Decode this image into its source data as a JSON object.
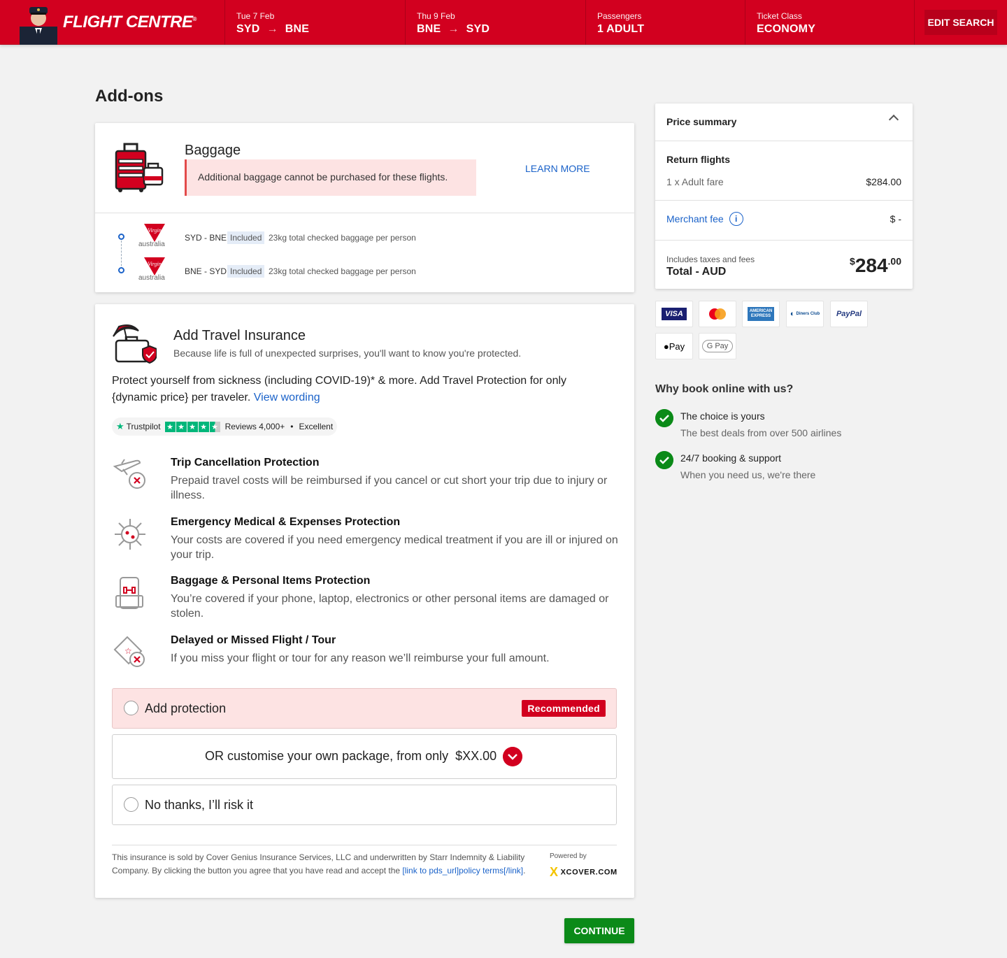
{
  "header": {
    "brand": "FLIGHT CENTRE",
    "outbound": {
      "label": "Tue 7 Feb",
      "from": "SYD",
      "to": "BNE"
    },
    "inbound": {
      "label": "Thu 9 Feb",
      "from": "BNE",
      "to": "SYD"
    },
    "passengers": {
      "label": "Passengers",
      "value": "1 ADULT"
    },
    "ticket_class": {
      "label": "Ticket Class",
      "value": "ECONOMY"
    },
    "edit_label": "EDIT SEARCH"
  },
  "page": {
    "title": "Add-ons"
  },
  "baggage": {
    "title": "Baggage",
    "alert": "Additional baggage cannot be purchased for these flights.",
    "learn_more": "LEARN MORE",
    "airline_sub": "australia",
    "legs": [
      {
        "route": "SYD - BNE",
        "status": "Included",
        "desc": "23kg total checked baggage per person"
      },
      {
        "route": "BNE - SYD",
        "status": "Included",
        "desc": "23kg total checked baggage per person"
      }
    ]
  },
  "insurance": {
    "title": "Add Travel Insurance",
    "subtitle": "Because life is full of unexpected surprises, you'll want to know you're protected.",
    "body": "Protect yourself from sickness (including COVID-19)* & more. Add Travel Protection for only {dynamic price} per traveler.",
    "view_wording": "View wording",
    "trustpilot": {
      "brand": "Trustpilot",
      "reviews": "Reviews 4,000+",
      "sep": "•",
      "rating": "Excellent"
    },
    "features": [
      {
        "title": "Trip Cancellation Protection",
        "desc": "Prepaid travel costs will be reimbursed if you cancel or cut short your trip due to injury or illness."
      },
      {
        "title": "Emergency Medical & Expenses Protection",
        "desc": "Your costs are covered if you need emergency medical treatment if you are ill or injured on your trip."
      },
      {
        "title": "Baggage & Personal Items Protection",
        "desc": "You’re covered if your phone, laptop, electronics or other personal items are damaged or stolen."
      },
      {
        "title": "Delayed or Missed Flight / Tour",
        "desc": "If you miss your flight or tour for any reason we’ll reimburse your full amount."
      }
    ],
    "opt_add": "Add protection",
    "recommended": "Recommended",
    "opt_custom": "OR customise your own package, from only  $XX.00",
    "opt_none": "No thanks, I’ll risk it",
    "legal": "This insurance is sold by Cover Genius Insurance Services, LLC and underwritten by Starr Indemnity & Liability Company. By clicking the button you agree that you have read and accept the",
    "legal_link": "[link to pds_url]policy terms[/link]",
    "legal_end": ".",
    "powered_by": "Powered by",
    "xcover": "XCOVER.COM"
  },
  "continue_label": "CONTINUE",
  "summary": {
    "title": "Price summary",
    "return_flights": "Return flights",
    "adult_fare": "1 x Adult fare",
    "adult_fare_value": "$284.00",
    "merchant_fee": "Merchant fee",
    "merchant_fee_value": "$ -",
    "includes": "Includes taxes and fees",
    "total_label": "Total - AUD",
    "total_currency": "$",
    "total_main": "284",
    "total_cents": ".00"
  },
  "payments": [
    "VISA",
    "Mastercard",
    "AMERICAN EXPRESS",
    "Diners Club",
    "PayPal",
    "Apple Pay",
    "G Pay"
  ],
  "payment_labels": {
    "visa": "VISA",
    "amex": "AMERICAN EXPRESS",
    "diners": "Diners Club",
    "paypal": "PayPal",
    "apple": "Pay",
    "gpay": "G Pay"
  },
  "why": {
    "title": "Why book online with us?",
    "items": [
      {
        "title": "The choice is yours",
        "desc": "The best deals from over 500 airlines"
      },
      {
        "title": "24/7 booking & support",
        "desc": "When you need us, we're there"
      }
    ]
  },
  "colors": {
    "brand_red": "#d2001f",
    "link_blue": "#1a62c9",
    "success_green": "#0b8a18",
    "trustpilot_green": "#00b67a"
  }
}
